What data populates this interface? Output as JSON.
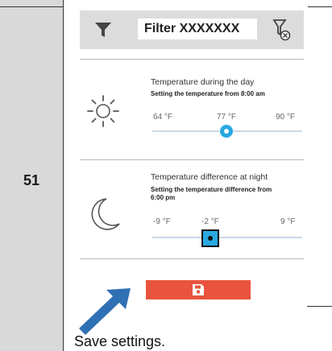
{
  "step": {
    "number": "51"
  },
  "filter": {
    "name": "Filter XXXXXXX"
  },
  "day": {
    "title": "Temperature during the day",
    "subtitle": "Setting the temperature from 8:00 am",
    "min": "64 °F",
    "value": "77 °F",
    "max": "90 °F"
  },
  "night": {
    "title": "Temperature difference at night",
    "subtitle_1": "Setting the temperature difference from",
    "subtitle_2": "6:00 pm",
    "min": "-9 °F",
    "value": "-2 °F",
    "max": "9 °F"
  },
  "caption": "Save settings.",
  "icons": {
    "filter": "funnel-icon",
    "clear": "clear-filter-icon",
    "day": "sun-icon",
    "night": "moon-icon",
    "save": "floppy-disk-icon",
    "pointer": "arrow-icon"
  },
  "colors": {
    "accent": "#29a8e2",
    "save_button": "#e8543e",
    "arrow": "#2f6fb4"
  }
}
